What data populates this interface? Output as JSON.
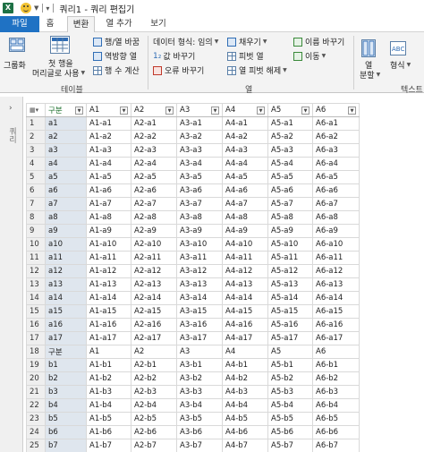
{
  "titlebar": {
    "title": "쿼리1 - 쿼리 편집기",
    "app_badge": "X"
  },
  "tabs": {
    "file": "파일",
    "home": "홈",
    "transform": "변환",
    "add_column": "열 추가",
    "view": "보기"
  },
  "ribbon": {
    "group_table": {
      "group_by": "그룹화",
      "first_row_header_l1": "첫 행을",
      "first_row_header_l2": "머리글로 사용",
      "transpose": "행/열 바꿈",
      "reverse_rows": "역방향 열",
      "count_rows": "행 수 계산",
      "label": "테이블"
    },
    "group_any_column": {
      "data_type": "데이터 형식: 임의",
      "replace_values": "값 바꾸기",
      "replace_errors": "오류 바꾸기",
      "fill": "채우기",
      "pivot_column": "피벗 열",
      "unpivot_columns": "열 피벗 해제",
      "rename": "이름 바꾸기",
      "move": "이동",
      "label": "열"
    },
    "group_text": {
      "split_column_l1": "열",
      "split_column_l2": "분할",
      "format": "형식",
      "label": "텍스트"
    }
  },
  "query_panel": {
    "label": "쿼리"
  },
  "grid": {
    "columns": [
      "구분",
      "A1",
      "A2",
      "A3",
      "A4",
      "A5",
      "A6"
    ],
    "rows": [
      [
        1,
        "a1",
        "A1-a1",
        "A2-a1",
        "A3-a1",
        "A4-a1",
        "A5-a1",
        "A6-a1"
      ],
      [
        2,
        "a2",
        "A1-a2",
        "A2-a2",
        "A3-a2",
        "A4-a2",
        "A5-a2",
        "A6-a2"
      ],
      [
        3,
        "a3",
        "A1-a3",
        "A2-a3",
        "A3-a3",
        "A4-a3",
        "A5-a3",
        "A6-a3"
      ],
      [
        4,
        "a4",
        "A1-a4",
        "A2-a4",
        "A3-a4",
        "A4-a4",
        "A5-a4",
        "A6-a4"
      ],
      [
        5,
        "a5",
        "A1-a5",
        "A2-a5",
        "A3-a5",
        "A4-a5",
        "A5-a5",
        "A6-a5"
      ],
      [
        6,
        "a6",
        "A1-a6",
        "A2-a6",
        "A3-a6",
        "A4-a6",
        "A5-a6",
        "A6-a6"
      ],
      [
        7,
        "a7",
        "A1-a7",
        "A2-a7",
        "A3-a7",
        "A4-a7",
        "A5-a7",
        "A6-a7"
      ],
      [
        8,
        "a8",
        "A1-a8",
        "A2-a8",
        "A3-a8",
        "A4-a8",
        "A5-a8",
        "A6-a8"
      ],
      [
        9,
        "a9",
        "A1-a9",
        "A2-a9",
        "A3-a9",
        "A4-a9",
        "A5-a9",
        "A6-a9"
      ],
      [
        10,
        "a10",
        "A1-a10",
        "A2-a10",
        "A3-a10",
        "A4-a10",
        "A5-a10",
        "A6-a10"
      ],
      [
        11,
        "a11",
        "A1-a11",
        "A2-a11",
        "A3-a11",
        "A4-a11",
        "A5-a11",
        "A6-a11"
      ],
      [
        12,
        "a12",
        "A1-a12",
        "A2-a12",
        "A3-a12",
        "A4-a12",
        "A5-a12",
        "A6-a12"
      ],
      [
        13,
        "a13",
        "A1-a13",
        "A2-a13",
        "A3-a13",
        "A4-a13",
        "A5-a13",
        "A6-a13"
      ],
      [
        14,
        "a14",
        "A1-a14",
        "A2-a14",
        "A3-a14",
        "A4-a14",
        "A5-a14",
        "A6-a14"
      ],
      [
        15,
        "a15",
        "A1-a15",
        "A2-a15",
        "A3-a15",
        "A4-a15",
        "A5-a15",
        "A6-a15"
      ],
      [
        16,
        "a16",
        "A1-a16",
        "A2-a16",
        "A3-a16",
        "A4-a16",
        "A5-a16",
        "A6-a16"
      ],
      [
        17,
        "a17",
        "A1-a17",
        "A2-a17",
        "A3-a17",
        "A4-a17",
        "A5-a17",
        "A6-a17"
      ],
      [
        18,
        "구분",
        "A1",
        "A2",
        "A3",
        "A4",
        "A5",
        "A6"
      ],
      [
        19,
        "b1",
        "A1-b1",
        "A2-b1",
        "A3-b1",
        "A4-b1",
        "A5-b1",
        "A6-b1"
      ],
      [
        20,
        "b2",
        "A1-b2",
        "A2-b2",
        "A3-b2",
        "A4-b2",
        "A5-b2",
        "A6-b2"
      ],
      [
        21,
        "b3",
        "A1-b3",
        "A2-b3",
        "A3-b3",
        "A4-b3",
        "A5-b3",
        "A6-b3"
      ],
      [
        22,
        "b4",
        "A1-b4",
        "A2-b4",
        "A3-b4",
        "A4-b4",
        "A5-b4",
        "A6-b4"
      ],
      [
        23,
        "b5",
        "A1-b5",
        "A2-b5",
        "A3-b5",
        "A4-b5",
        "A5-b5",
        "A6-b5"
      ],
      [
        24,
        "b6",
        "A1-b6",
        "A2-b6",
        "A3-b6",
        "A4-b6",
        "A5-b6",
        "A6-b6"
      ],
      [
        25,
        "b7",
        "A1-b7",
        "A2-b7",
        "A3-b7",
        "A4-b7",
        "A5-b7",
        "A6-b7"
      ]
    ]
  },
  "colors": {
    "file_tab": "#1f72c4",
    "selected_column": "#dfe6ee",
    "excel_green": "#1e7145",
    "header_text_selected": "#1a6e2a"
  }
}
